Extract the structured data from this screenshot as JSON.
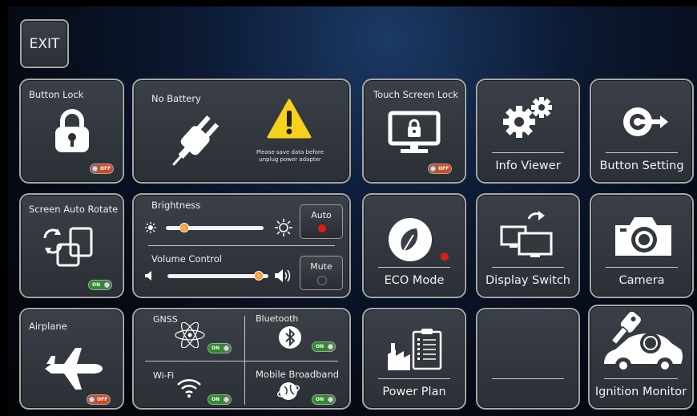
{
  "exit_label": "EXIT",
  "tiles": {
    "button_lock": {
      "title": "Button Lock",
      "toggle": "OFF"
    },
    "battery": {
      "title": "No Battery",
      "warning": "Please save data before unplug power adapter",
      "warning_line1": "Please save data before",
      "warning_line2": "unplug power adapter"
    },
    "touch_lock": {
      "title": "Touch Screen Lock",
      "toggle": "OFF"
    },
    "info_viewer": {
      "label": "Info Viewer"
    },
    "button_setting": {
      "label": "Button Setting"
    },
    "auto_rotate": {
      "title": "Screen Auto Rotate",
      "toggle": "ON"
    },
    "brightness": {
      "title": "Brightness",
      "auto_label": "Auto",
      "level": 0.15
    },
    "volume": {
      "title": "Volume Control",
      "mute_label": "Mute",
      "level": 0.95
    },
    "eco_mode": {
      "label": "ECO Mode"
    },
    "display_switch": {
      "label": "Display Switch"
    },
    "camera": {
      "label": "Camera"
    },
    "airplane": {
      "title": "Airplane",
      "toggle": "OFF"
    },
    "gnss": {
      "title": "GNSS",
      "toggle": "ON"
    },
    "bluetooth": {
      "title": "Bluetooth",
      "toggle": "ON"
    },
    "wifi": {
      "title": "Wi-Fi",
      "toggle": "ON"
    },
    "mobile": {
      "title": "Mobile Broadband",
      "toggle": "ON"
    },
    "power_plan": {
      "label": "Power Plan"
    },
    "empty": {
      "label": ""
    },
    "ignition": {
      "label": "Ignition Monitor"
    }
  },
  "colors": {
    "accent_off": "#d14a24",
    "accent_on": "#2f8a2c",
    "indicator_red": "#e0191b",
    "slider_knob": "#f08a1c"
  }
}
